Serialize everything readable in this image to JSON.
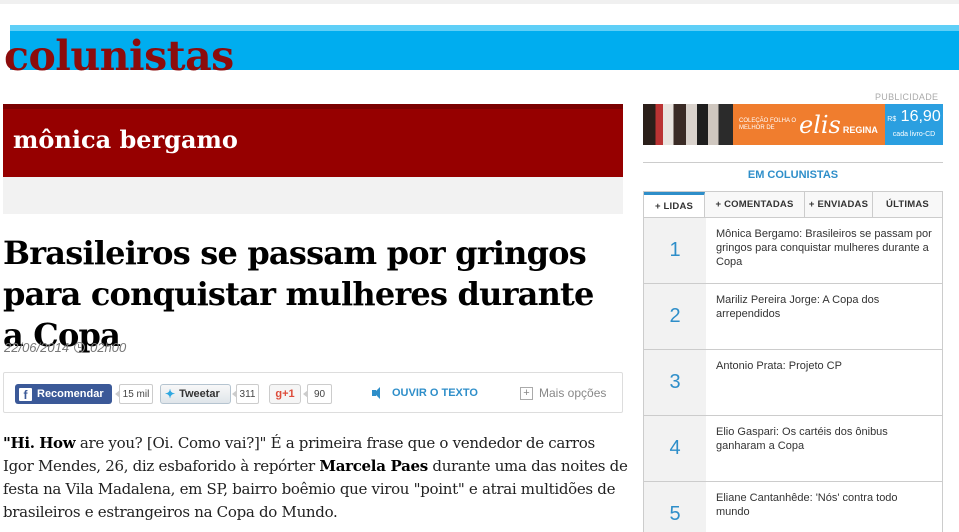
{
  "header": {
    "section_title": "colunistas"
  },
  "column": {
    "columnist_name": "mônica bergamo"
  },
  "article": {
    "headline": "Brasileiros se passam por gringos para conquistar mulheres durante a Copa",
    "date": "22/06/2014",
    "time": "02h00",
    "body": {
      "q1": "\"Hi.",
      "q2": "How",
      "q3": " are you? [Oi. Como vai?]\" É a primeira frase que o vendedor de carros Igor Mendes, 26, diz esbaforido à repórter ",
      "reporter": "Marcela Paes",
      "q4": " durante uma das noites de festa na Vila Madalena, em SP, bairro boêmio que virou \"point\" e atrai multidões de brasileiros e estrangeiros na Copa do Mundo."
    }
  },
  "share": {
    "facebook_label": "Recomendar",
    "facebook_count": "15 mil",
    "twitter_label": "Tweetar",
    "twitter_count": "311",
    "gplus_label": "g+1",
    "gplus_count": "90",
    "listen_label": "OUVIR O TEXTO",
    "more_label": "Mais opções"
  },
  "sidebar": {
    "ad_label": "PUBLICIDADE",
    "ad": {
      "collection_text": "COLEÇÃO FOLHA O MELHOR DE",
      "brand_text": "elis",
      "brand_sub": "REGINA",
      "price_prefix": "R$",
      "price_value": "16,90",
      "price_note": "cada livro-CD"
    },
    "ranking_title": "EM COLUNISTAS",
    "tabs": [
      "+ LIDAS",
      "+ COMENTADAS",
      "+ ENVIADAS",
      "ÚLTIMAS"
    ],
    "items": [
      {
        "rank": "1",
        "text": "Mônica Bergamo: Brasileiros se passam por gringos para conquistar mulheres durante a Copa"
      },
      {
        "rank": "2",
        "text": "Mariliz Pereira Jorge: A Copa dos arrependidos"
      },
      {
        "rank": "3",
        "text": "Antonio Prata: Projeto CP"
      },
      {
        "rank": "4",
        "text": "Elio Gaspari: Os cartéis dos ônibus ganharam a Copa"
      },
      {
        "rank": "5",
        "text": "Eliane Cantanhêde: 'Nós' contra todo mundo"
      }
    ]
  },
  "colors": {
    "brand_red": "#960000",
    "title_red": "#8c0c0c",
    "cyan": "#00adef",
    "link_blue": "#2e8ec9",
    "facebook_blue": "#3b5998"
  }
}
